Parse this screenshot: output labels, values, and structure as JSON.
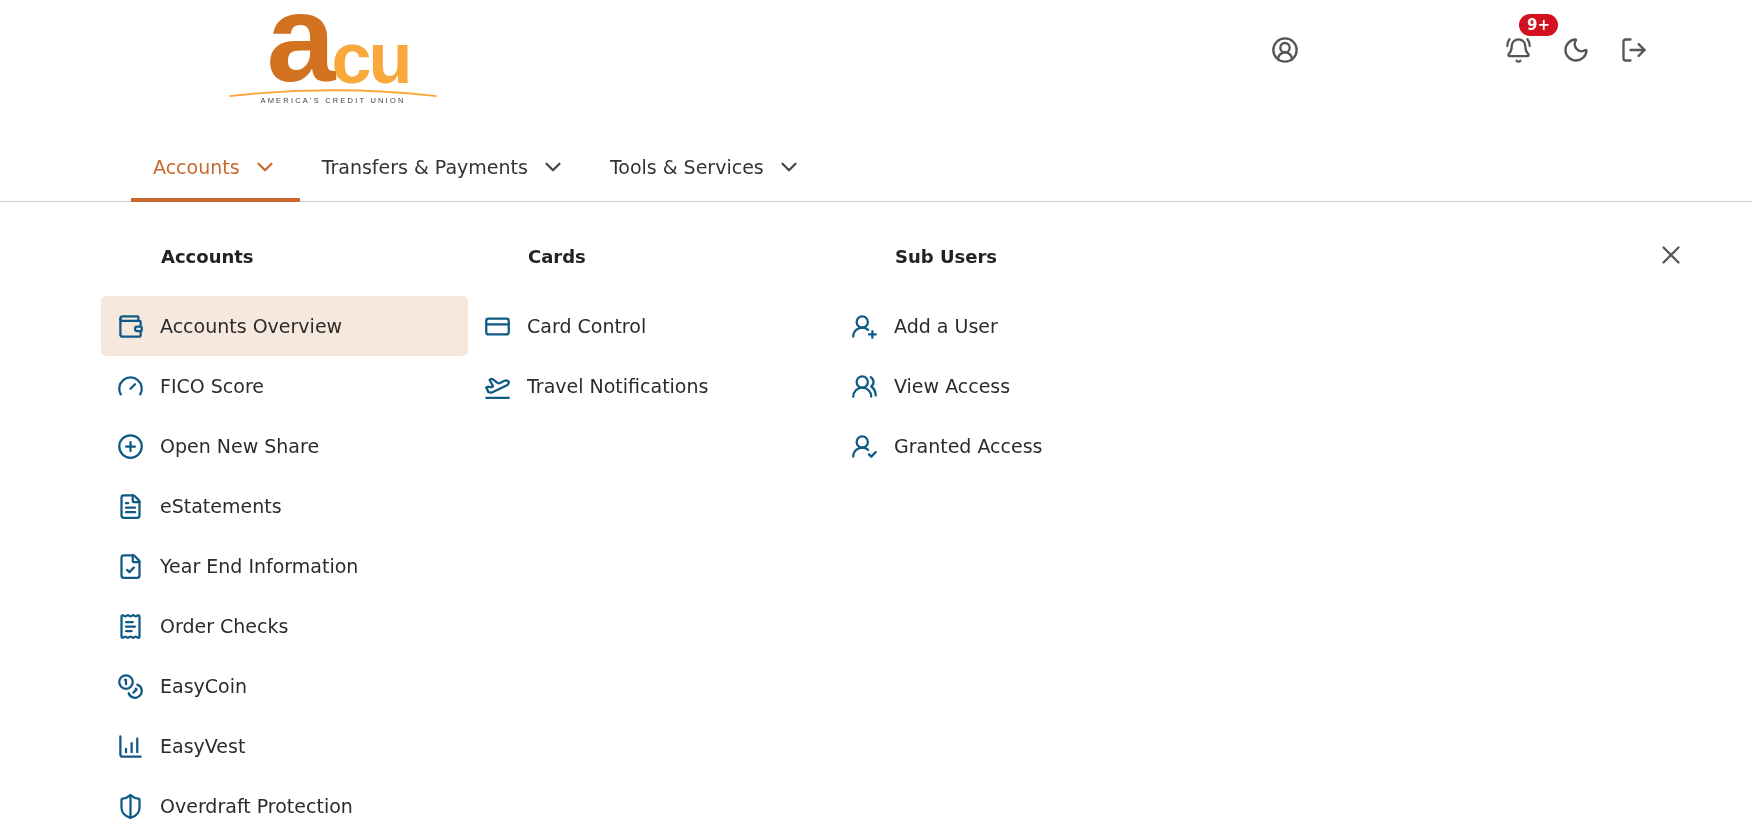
{
  "logo": {
    "mark_primary": "a",
    "mark_secondary": "cu",
    "tagline": "AMERICA'S CREDIT UNION"
  },
  "header": {
    "notification_badge": "9+"
  },
  "tabs": [
    {
      "label": "Accounts",
      "selected": true
    },
    {
      "label": "Transfers & Payments",
      "selected": false
    },
    {
      "label": "Tools & Services",
      "selected": false
    }
  ],
  "menu_columns": [
    {
      "heading": "Accounts",
      "items": [
        {
          "label": "Accounts Overview",
          "selected": true
        },
        {
          "label": "FICO Score",
          "selected": false
        },
        {
          "label": "Open New Share",
          "selected": false
        },
        {
          "label": "eStatements",
          "selected": false
        },
        {
          "label": "Year End Information",
          "selected": false
        },
        {
          "label": "Order Checks",
          "selected": false
        },
        {
          "label": "EasyCoin",
          "selected": false
        },
        {
          "label": "EasyVest",
          "selected": false
        },
        {
          "label": "Overdraft Protection",
          "selected": false
        }
      ]
    },
    {
      "heading": "Cards",
      "items": [
        {
          "label": "Card Control",
          "selected": false
        },
        {
          "label": "Travel Notifications",
          "selected": false
        }
      ]
    },
    {
      "heading": "Sub Users",
      "items": [
        {
          "label": "Add a User",
          "selected": false
        },
        {
          "label": "View Access",
          "selected": false
        },
        {
          "label": "Granted Access",
          "selected": false
        }
      ]
    }
  ]
}
